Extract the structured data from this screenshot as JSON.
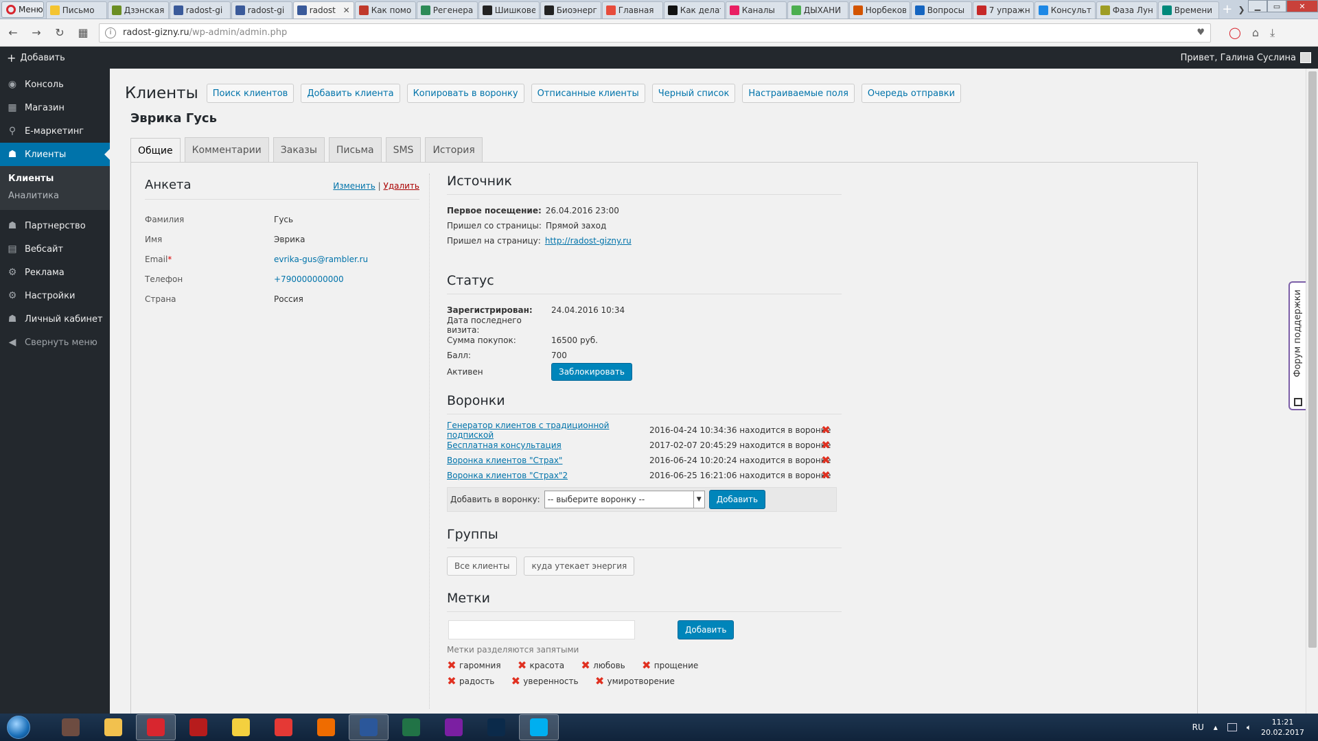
{
  "browser": {
    "menu_label": "Меню",
    "tabs": [
      {
        "title": "Письмо",
        "color": "#f4c430",
        "active": false
      },
      {
        "title": "Дзэнская",
        "color": "#6b8e23",
        "active": false
      },
      {
        "title": "radost-gi",
        "color": "#3a5a9a",
        "active": false
      },
      {
        "title": "radost-gi",
        "color": "#3a5a9a",
        "active": false
      },
      {
        "title": "radost",
        "color": "#3a5a9a",
        "active": true
      },
      {
        "title": "Как помо",
        "color": "#c0392b",
        "active": false
      },
      {
        "title": "Регенера",
        "color": "#2e8b57",
        "active": false
      },
      {
        "title": "Шишкове",
        "color": "#222222",
        "active": false
      },
      {
        "title": "Биоэнерг",
        "color": "#222222",
        "active": false
      },
      {
        "title": "Главная",
        "color": "#e74c3c",
        "active": false
      },
      {
        "title": "Как делат",
        "color": "#111111",
        "active": false
      },
      {
        "title": "Каналы",
        "color": "#e91e63",
        "active": false
      },
      {
        "title": "ДЫХАНИ",
        "color": "#4caf50",
        "active": false
      },
      {
        "title": "Норбеков",
        "color": "#d35400",
        "active": false
      },
      {
        "title": "Вопросы",
        "color": "#1565c0",
        "active": false
      },
      {
        "title": "7 упражн",
        "color": "#c62828",
        "active": false
      },
      {
        "title": "Консульт",
        "color": "#1e88e5",
        "active": false
      },
      {
        "title": "Фаза Лун",
        "color": "#9e9d24",
        "active": false
      },
      {
        "title": "Времени",
        "color": "#00897b",
        "active": false
      }
    ],
    "url_host": "radost-gizny.ru",
    "url_path": "/wp-admin/admin.php"
  },
  "adminbar": {
    "add_label": "Добавить",
    "greeting": "Привет, Галина Суслина"
  },
  "sidebar": {
    "items": [
      {
        "label": "Консоль",
        "icon": "dashboard-icon",
        "glyph": "◉"
      },
      {
        "label": "Магазин",
        "icon": "shop-icon",
        "glyph": "▦"
      },
      {
        "label": "E-маркетинг",
        "icon": "marketing-icon",
        "glyph": "⚲"
      },
      {
        "label": "Клиенты",
        "icon": "clients-icon",
        "glyph": "☗"
      }
    ],
    "submenu": [
      "Клиенты",
      "Аналитика"
    ],
    "items2": [
      {
        "label": "Партнерство",
        "icon": "partners-icon",
        "glyph": "☗"
      },
      {
        "label": "Вебсайт",
        "icon": "website-icon",
        "glyph": "▤"
      },
      {
        "label": "Реклама",
        "icon": "ads-icon",
        "glyph": "⚙"
      },
      {
        "label": "Настройки",
        "icon": "settings-icon",
        "glyph": "⚙"
      },
      {
        "label": "Личный кабинет",
        "icon": "account-icon",
        "glyph": "☗"
      }
    ],
    "collapse": "Свернуть меню"
  },
  "header": {
    "title": "Клиенты",
    "buttons": [
      "Поиск клиентов",
      "Добавить клиента",
      "Копировать в воронку",
      "Отписанные клиенты",
      "Черный список",
      "Настраиваемые поля",
      "Очередь отправки"
    ]
  },
  "client_name": "Эврика Гусь",
  "tabs": [
    "Общие",
    "Комментарии",
    "Заказы",
    "Письма",
    "SMS",
    "История"
  ],
  "anketa": {
    "title": "Анкета",
    "edit": "Изменить",
    "sep": "|",
    "delete": "Удалить",
    "fields": [
      {
        "label": "Фамилия",
        "value": "Гусь",
        "link": false,
        "req": ""
      },
      {
        "label": "Имя",
        "value": "Эврика",
        "link": false,
        "req": ""
      },
      {
        "label": "Email",
        "value": "evrika-gus@rambler.ru",
        "link": true,
        "req": "*"
      },
      {
        "label": "Телефон",
        "value": "+790000000000",
        "link": true,
        "req": ""
      },
      {
        "label": "Страна",
        "value": "Россия",
        "link": false,
        "req": ""
      }
    ]
  },
  "source": {
    "title": "Источник",
    "first_visit_label": "Первое посещение:",
    "first_visit_value": "26.04.2016 23:00",
    "from_label": "Пришел со страницы:",
    "from_value": "Прямой заход",
    "to_label": "Пришел на страницу:",
    "to_value": "http://radost-gizny.ru"
  },
  "status": {
    "title": "Статус",
    "rows": [
      {
        "label": "Зарегистрирован:",
        "value": "24.04.2016 10:34",
        "bold": true
      },
      {
        "label": "Дата последнего визита:",
        "value": "",
        "bold": false
      },
      {
        "label": "Сумма покупок:",
        "value": "16500 руб.",
        "bold": false
      },
      {
        "label": "Балл:",
        "value": "700",
        "bold": false
      }
    ],
    "active_label": "Активен",
    "block_button": "Заблокировать"
  },
  "funnels": {
    "title": "Воронки",
    "items": [
      {
        "name": "Генератор клиентов с традиционной подпиской",
        "info": "2016-04-24 10:34:36 находится в воронке"
      },
      {
        "name": "Бесплатная консультация",
        "info": "2017-02-07 20:45:29 находится в воронке"
      },
      {
        "name": "Воронка клиентов \"Страх\"",
        "info": "2016-06-24 10:20:24 находится в воронке"
      },
      {
        "name": "Воронка клиентов \"Страх\"2",
        "info": "2016-06-25 16:21:06 находится в воронке"
      }
    ],
    "add_label": "Добавить в воронку:",
    "select_value": "-- выберите воронку --",
    "add_button": "Добавить"
  },
  "groups": {
    "title": "Группы",
    "items": [
      "Все клиенты",
      "куда утекает энергия"
    ]
  },
  "tags": {
    "title": "Метки",
    "add_button": "Добавить",
    "hint": "Метки разделяются запятыми",
    "row1": [
      "гаромния",
      "красота",
      "любовь",
      "прощение"
    ],
    "row2": [
      "радость",
      "уверенность",
      "умиротворение"
    ]
  },
  "support": "Форум поддержки",
  "taskbar": {
    "apps": [
      {
        "icon": "movies-icon",
        "color": "#6d4c41",
        "active": false
      },
      {
        "icon": "explorer-icon",
        "color": "#f2c14e",
        "active": false
      },
      {
        "icon": "opera-icon",
        "color": "#d8262f",
        "active": true
      },
      {
        "icon": "pdf-icon",
        "color": "#b71c1c",
        "active": false
      },
      {
        "icon": "archicad-icon",
        "color": "#f4d03f",
        "active": false
      },
      {
        "icon": "xmind-icon",
        "color": "#e53935",
        "active": false
      },
      {
        "icon": "firefox-icon",
        "color": "#ef6c00",
        "active": false
      },
      {
        "icon": "word-icon",
        "color": "#2b579a",
        "active": true
      },
      {
        "icon": "excel-icon",
        "color": "#217346",
        "active": false
      },
      {
        "icon": "app-icon",
        "color": "#7b1fa2",
        "active": false
      },
      {
        "icon": "photoshop-icon",
        "color": "#0b2a4a",
        "active": false
      },
      {
        "icon": "skype-icon",
        "color": "#00aff0",
        "active": true
      }
    ],
    "lang": "RU",
    "time": "11:21",
    "date": "20.02.2017"
  }
}
